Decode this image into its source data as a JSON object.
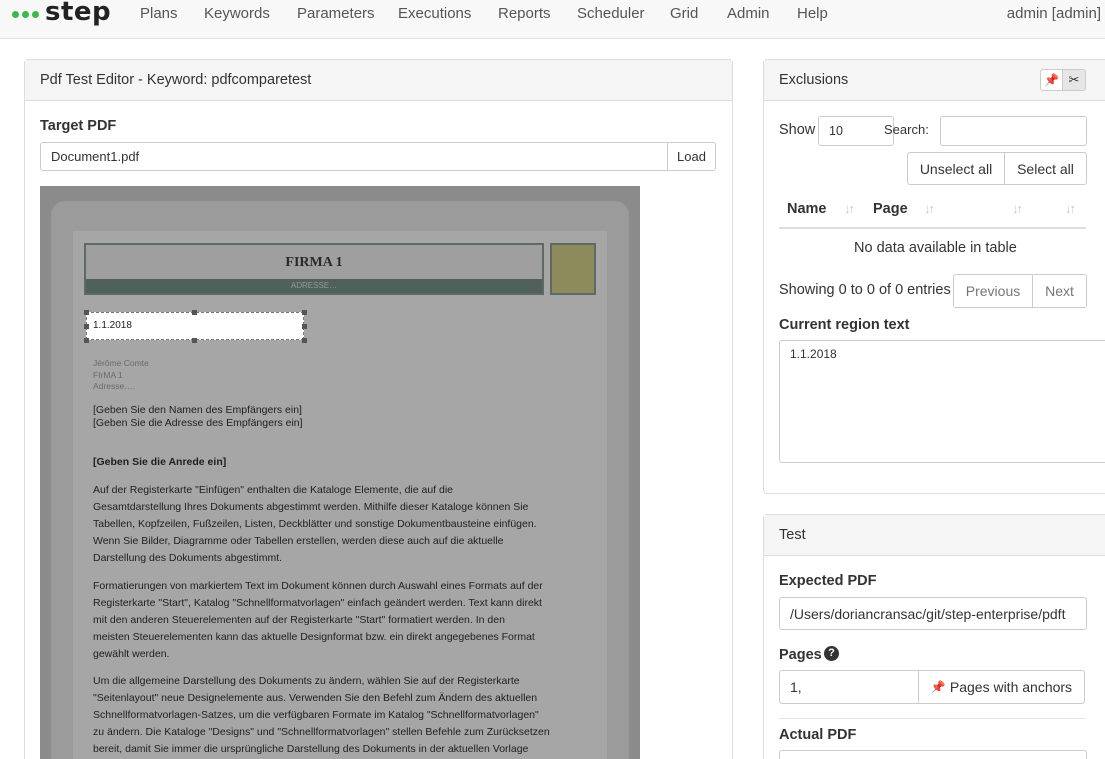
{
  "brand": {
    "name": "step"
  },
  "nav": {
    "items": [
      "Plans",
      "Keywords",
      "Parameters",
      "Executions",
      "Reports",
      "Scheduler",
      "Grid",
      "Admin",
      "Help"
    ],
    "user": "admin [admin]"
  },
  "editor": {
    "title": "Pdf Test Editor - Keyword: pdfcomparetest",
    "target_label": "Target PDF",
    "target_value": "Document1.pdf",
    "load_label": "Load"
  },
  "pdf": {
    "firma": "FIRMA 1",
    "adresse": "ADRESSE…",
    "selected_text": "1.1.2018",
    "sender_lines": [
      "Jérôme Comte",
      "FIrMA 1",
      "Adresse…."
    ],
    "recipient_lines": [
      "[Geben Sie den Namen des Empfängers ein]",
      "[Geben Sie die Adresse des Empfängers ein]"
    ],
    "salutation": "[Geben Sie die Anrede ein]",
    "para1": [
      "Auf der Registerkarte \"Einfügen\" enthalten die Kataloge Elemente, die auf die",
      "Gesamtdarstellung Ihres Dokuments abgestimmt werden. Mithilfe dieser Kataloge können Sie",
      "Tabellen, Kopfzeilen, Fußzeilen, Listen, Deckblätter und sonstige Dokumentbausteine einfügen.",
      "Wenn Sie Bilder, Diagramme oder Tabellen erstellen, werden diese auch auf die aktuelle",
      "Darstellung des Dokuments abgestimmt."
    ],
    "para2": [
      "Formatierungen von markiertem Text im Dokument können durch Auswahl eines Formats auf der",
      "Registerkarte \"Start\", Katalog \"Schnellformatvorlagen\" einfach geändert werden. Text kann direkt",
      "mit den anderen Steuerelementen auf der Registerkarte \"Start\" formatiert werden. In den",
      "meisten Steuerelementen kann das aktuelle Designformat bzw. ein direkt angegebenes Format",
      "gewählt werden."
    ],
    "para3": [
      "Um die allgemeine Darstellung des Dokuments zu ändern, wählen Sie auf der Registerkarte",
      "\"Seitenlayout\" neue Designelemente aus. Verwenden Sie den Befehl zum Ändern des aktuellen",
      "Schnellformatvorlagen-Satzes, um die verfügbaren Formate im Katalog \"Schnellformatvorlagen\"",
      "zu ändern. Die Kataloge \"Designs\" und \"Schnellformatvorlagen\" stellen Befehle zum Zurücksetzen",
      "bereit, damit Sie immer die ursprüngliche Darstellung des Dokuments in der aktuellen Vorlage"
    ]
  },
  "exclusions": {
    "title": "Exclusions",
    "show_label": "Show",
    "show_value": "10",
    "search_label": "Search:",
    "unselect_all": "Unselect all",
    "select_all": "Select all",
    "col_name": "Name",
    "col_page": "Page",
    "empty_text": "No data available in table",
    "showing_text": "Showing 0 to 0 of 0 entries",
    "prev_label": "Previous",
    "next_label": "Next",
    "region_label": "Current region text",
    "region_value": "1.1.2018"
  },
  "test": {
    "title": "Test",
    "expected_label": "Expected PDF",
    "expected_value": "/Users/doriancransac/git/step-enterprise/pdft",
    "pages_label": "Pages",
    "pages_value": "1,",
    "pages_anchors_label": "Pages with anchors",
    "actual_label": "Actual PDF"
  },
  "icons": {
    "pin": "pin-icon",
    "scissors": "scissors-icon",
    "help": "question-circle-icon"
  }
}
